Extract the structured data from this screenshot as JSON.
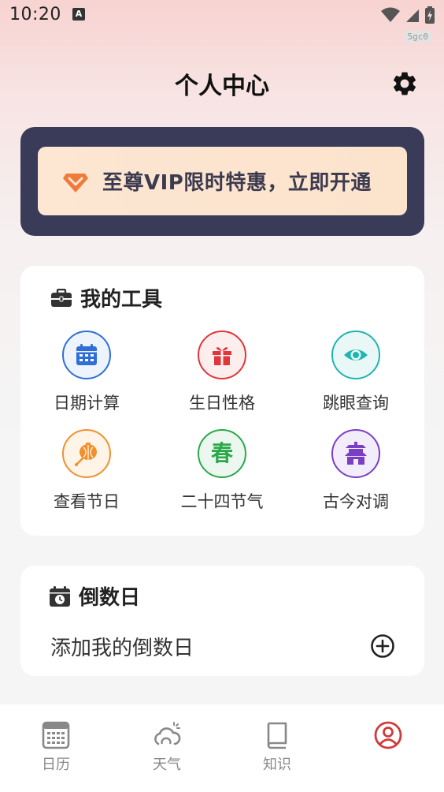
{
  "status_bar": {
    "time": "10:20",
    "notification_letter": "A",
    "debug_badge": "5gc0"
  },
  "header": {
    "title": "个人中心",
    "settings_icon": "gear-icon"
  },
  "vip_banner": {
    "text": "至尊VIP限时特惠，立即开通",
    "icon": "vip-diamond-icon"
  },
  "tools": {
    "title": "我的工具",
    "items": [
      {
        "label": "日期计算",
        "icon": "calendar-icon",
        "color": "#2f6fd6"
      },
      {
        "label": "生日性格",
        "icon": "gift-icon",
        "color": "#e0363a"
      },
      {
        "label": "跳眼查询",
        "icon": "eye-icon",
        "color": "#1fb5b0"
      },
      {
        "label": "查看节日",
        "icon": "lantern-icon",
        "color": "#f0912d"
      },
      {
        "label": "二十四节气",
        "icon": "spring-char-icon",
        "glyph": "春",
        "color": "#2aa84a"
      },
      {
        "label": "古今对调",
        "icon": "pavilion-icon",
        "color": "#7a3fc4"
      }
    ]
  },
  "countdown": {
    "title": "倒数日",
    "add_label": "添加我的倒数日"
  },
  "bottom_nav": {
    "items": [
      {
        "label": "日历",
        "icon": "calendar-grid-icon",
        "active": false
      },
      {
        "label": "天气",
        "icon": "weather-icon",
        "active": false
      },
      {
        "label": "知识",
        "icon": "book-icon",
        "active": false
      },
      {
        "label": "",
        "icon": "profile-icon",
        "active": true
      }
    ],
    "active_color": "#d23a3a",
    "inactive_color": "#888888"
  }
}
